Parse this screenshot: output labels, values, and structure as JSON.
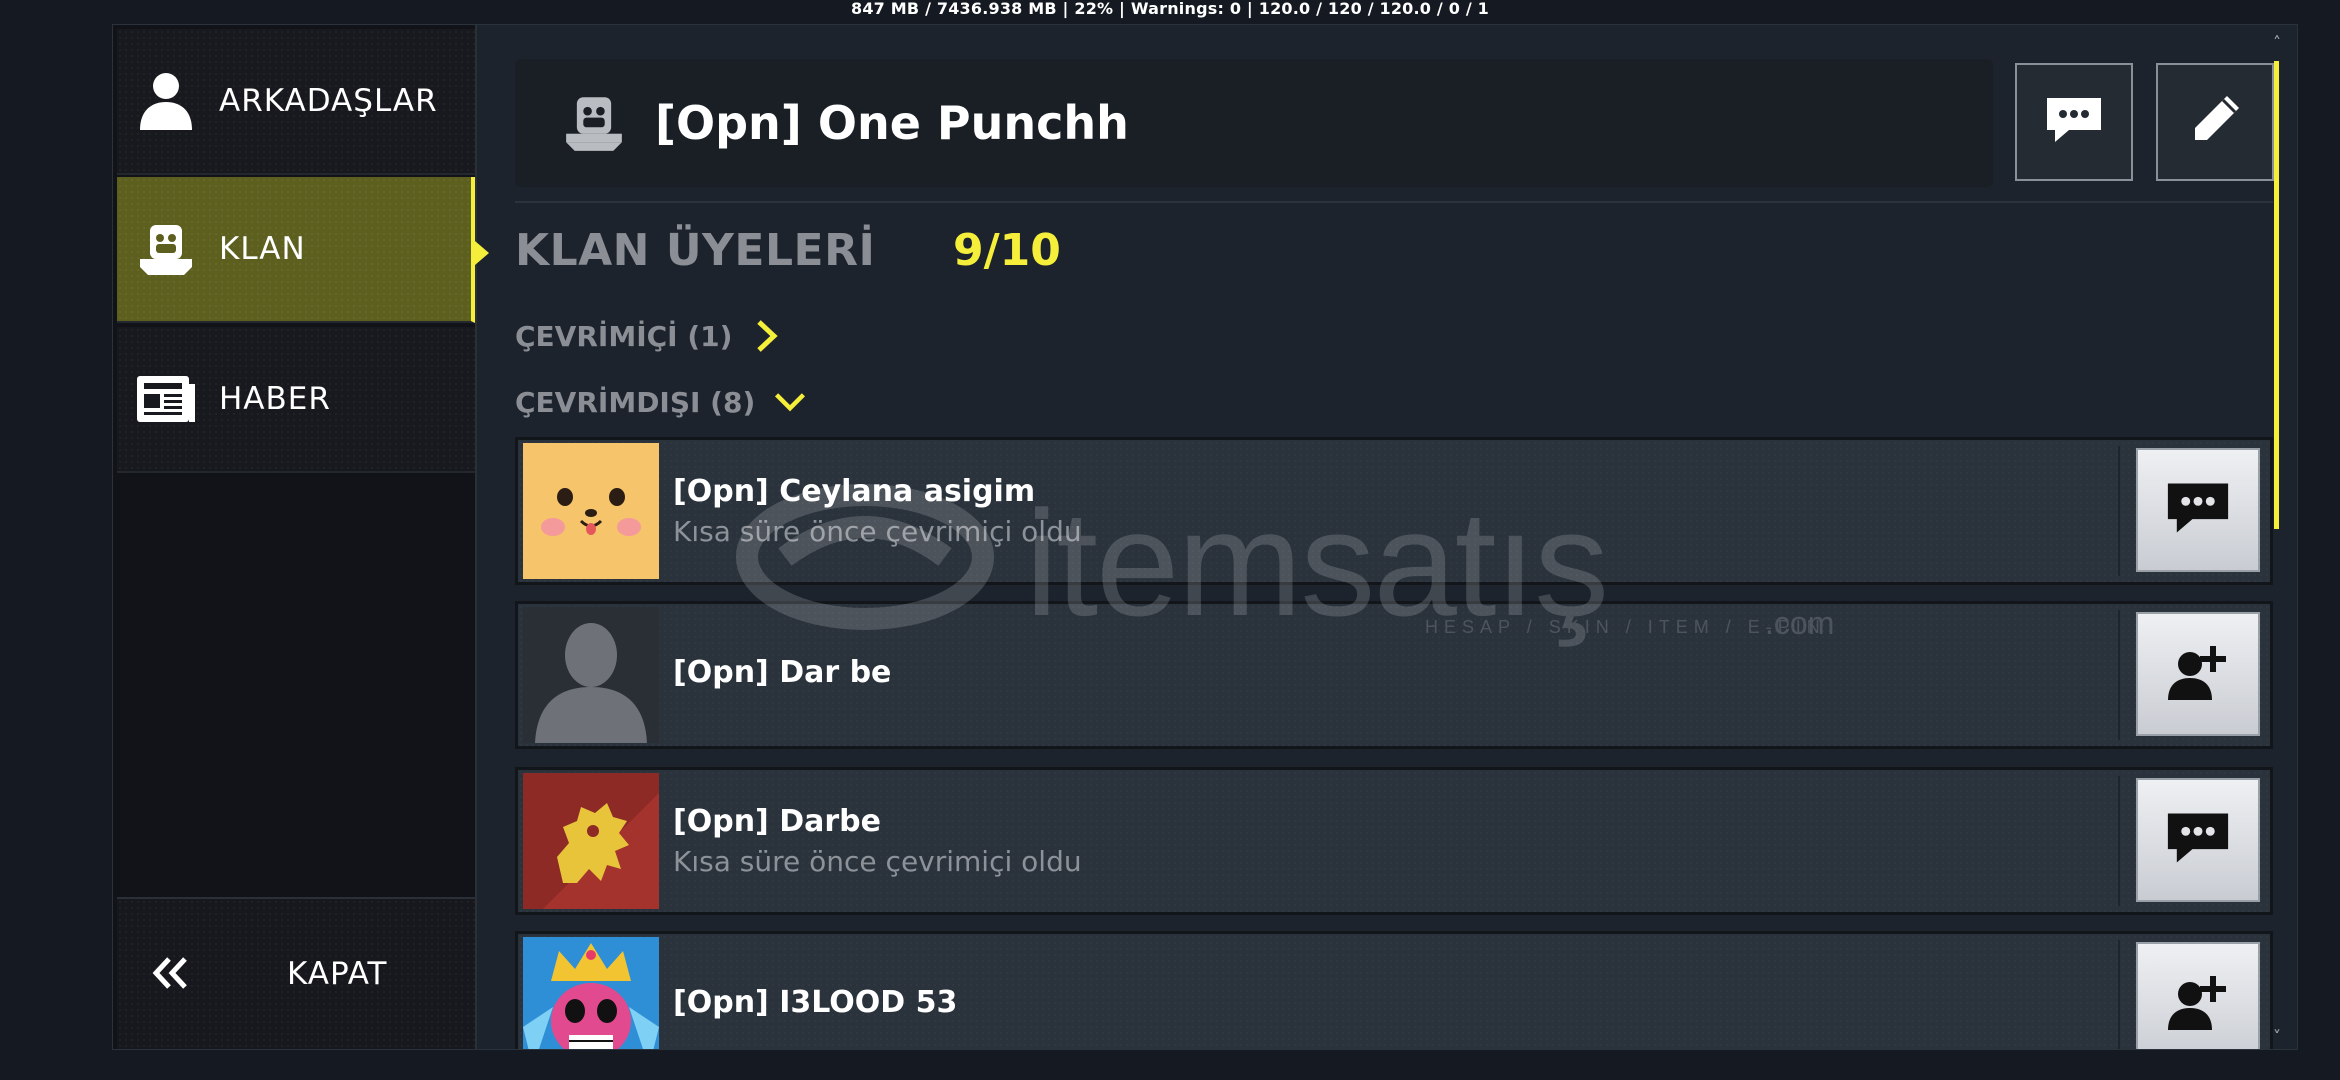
{
  "debug_bar": "847 MB / 7436.938 MB | 22% | Warnings: 0 | 120.0 / 120 / 120.0 / 0 / 1",
  "sidebar": {
    "items": [
      {
        "label": "ARKADAŞLAR",
        "icon": "person-icon"
      },
      {
        "label": "KLAN",
        "icon": "clan-emblem-icon",
        "active": true
      },
      {
        "label": "HABER",
        "icon": "newspaper-icon"
      }
    ],
    "close_label": "KAPAT",
    "close_icon": "double-chevron-left-icon"
  },
  "clan": {
    "name": "[Opn] One Punchh",
    "chat_button_icon": "chat-bubble-icon",
    "edit_button_icon": "pencil-icon"
  },
  "members": {
    "title": "KLAN ÜYELERİ",
    "count": "9/10",
    "online_label": "ÇEVRİMİÇİ (1)",
    "offline_label": "ÇEVRİMDIŞI (8)",
    "list": [
      {
        "name": "[Opn] Ceylana asigim",
        "status": "Kısa süre önce çevrimiçi oldu",
        "action_icon": "chat-bubble-icon",
        "avatar": "dog-face-avatar"
      },
      {
        "name": "[Opn] Dar be",
        "status": "",
        "action_icon": "add-friend-icon",
        "avatar": "default-silhouette-avatar"
      },
      {
        "name": "[Opn] Darbe",
        "status": "Kısa süre önce çevrimiçi oldu",
        "action_icon": "chat-bubble-icon",
        "avatar": "golden-lion-avatar"
      },
      {
        "name": "[Opn] I3LOOD 53",
        "status": "",
        "action_icon": "add-friend-icon",
        "avatar": "crowned-skull-avatar"
      }
    ]
  },
  "watermark": {
    "brand": "itemsatış",
    "tagline": "HESAP / SKIN / ITEM / E-PIN",
    "domain": ".com"
  },
  "colors": {
    "accent": "#f5ee3a",
    "background": "#1c232c",
    "active_item": "#5d5f1f"
  }
}
